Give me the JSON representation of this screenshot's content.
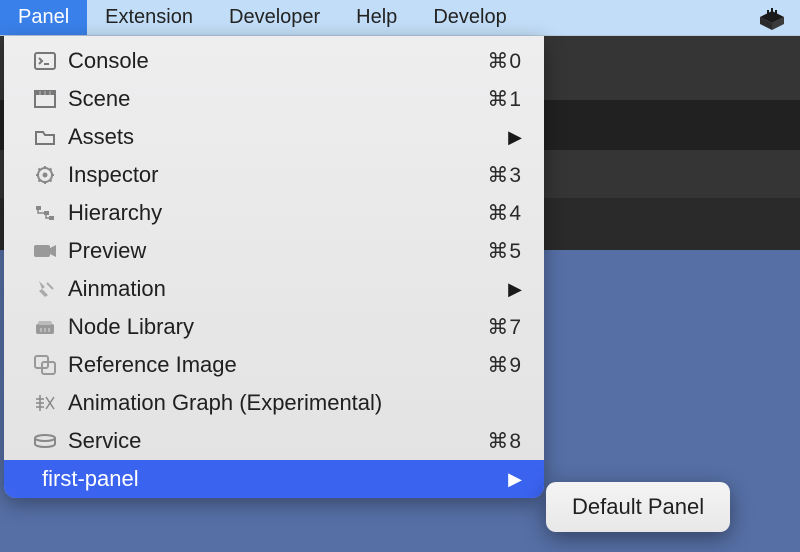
{
  "menubar": {
    "items": [
      {
        "label": "Panel",
        "active": true
      },
      {
        "label": "Extension",
        "active": false
      },
      {
        "label": "Developer",
        "active": false
      },
      {
        "label": "Help",
        "active": false
      },
      {
        "label": "Develop",
        "active": false
      }
    ]
  },
  "dropdown": {
    "items": [
      {
        "icon": "console-icon",
        "label": "Console",
        "shortcut": "⌘0"
      },
      {
        "icon": "scene-icon",
        "label": "Scene",
        "shortcut": "⌘1"
      },
      {
        "icon": "folder-icon",
        "label": "Assets",
        "submenu_arrow": "▶"
      },
      {
        "icon": "inspector-icon",
        "label": "Inspector",
        "shortcut": "⌘3"
      },
      {
        "icon": "hierarchy-icon",
        "label": "Hierarchy",
        "shortcut": "⌘4"
      },
      {
        "icon": "preview-icon",
        "label": "Preview",
        "shortcut": "⌘5"
      },
      {
        "icon": "animation-icon",
        "label": "Ainmation",
        "submenu_arrow": "▶"
      },
      {
        "icon": "library-icon",
        "label": "Node Library",
        "shortcut": "⌘7"
      },
      {
        "icon": "refimage-icon",
        "label": "Reference Image",
        "shortcut": "⌘9"
      },
      {
        "icon": "animgraph-icon",
        "label": "Animation Graph (Experimental)"
      },
      {
        "icon": "service-icon",
        "label": "Service",
        "shortcut": "⌘8"
      },
      {
        "icon": "",
        "label": "first-panel",
        "highlight": true,
        "submenu_arrow": "▶"
      }
    ]
  },
  "submenu": {
    "items": [
      {
        "label": "Default Panel"
      }
    ]
  }
}
